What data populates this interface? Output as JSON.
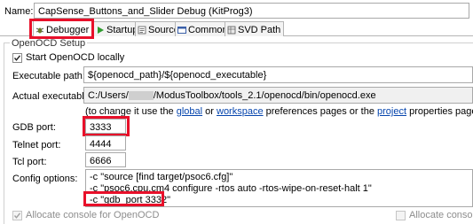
{
  "name_label": "Name:",
  "name_value": "CapSense_Buttons_and_Slider Debug (KitProg3)",
  "tabs": [
    {
      "label": "Debugger",
      "icon": "bug-icon"
    },
    {
      "label": "Startup",
      "icon": "run-arrow-icon"
    },
    {
      "label": "Source",
      "icon": "source-icon"
    },
    {
      "label": "Common",
      "icon": "common-icon"
    },
    {
      "label": "SVD Path",
      "icon": "svd-icon"
    }
  ],
  "section_title": "OpenOCD Setup",
  "start_locally": {
    "label": "Start OpenOCD locally",
    "checked": true
  },
  "executable_path": {
    "label": "Executable path:",
    "value": "${openocd_path}/${openocd_executable}"
  },
  "actual_executable": {
    "label": "Actual executable:",
    "prefix": "C:/Users/",
    "suffix": "/ModusToolbox/tools_2.1/openocd/bin/openocd.exe"
  },
  "hint": {
    "before": "(to change it use the ",
    "global": "global",
    "or": " or ",
    "workspace": "workspace",
    "middle": " preferences pages or the ",
    "project": "project",
    "after": " properties page)"
  },
  "gdb_port": {
    "label": "GDB port:",
    "value": "3333"
  },
  "telnet_port": {
    "label": "Telnet port:",
    "value": "4444"
  },
  "tcl_port": {
    "label": "Tcl port:",
    "value": "6666"
  },
  "config_options": {
    "label": "Config options:",
    "lines": [
      "-c \"source [find target/psoc6.cfg]\"",
      "-c \"psoc6.cpu.cm4 configure -rtos auto -rtos-wipe-on-reset-halt 1\"",
      "-c \"gdb_port 3332\""
    ]
  },
  "allocate_console": {
    "label": "Allocate console for OpenOCD",
    "checked": true,
    "enabled": false
  },
  "allocate_console_right": {
    "label": "Allocate console",
    "checked": false,
    "enabled": false
  },
  "colors": {
    "highlight": "#e8102a",
    "link": "#0645ad"
  }
}
